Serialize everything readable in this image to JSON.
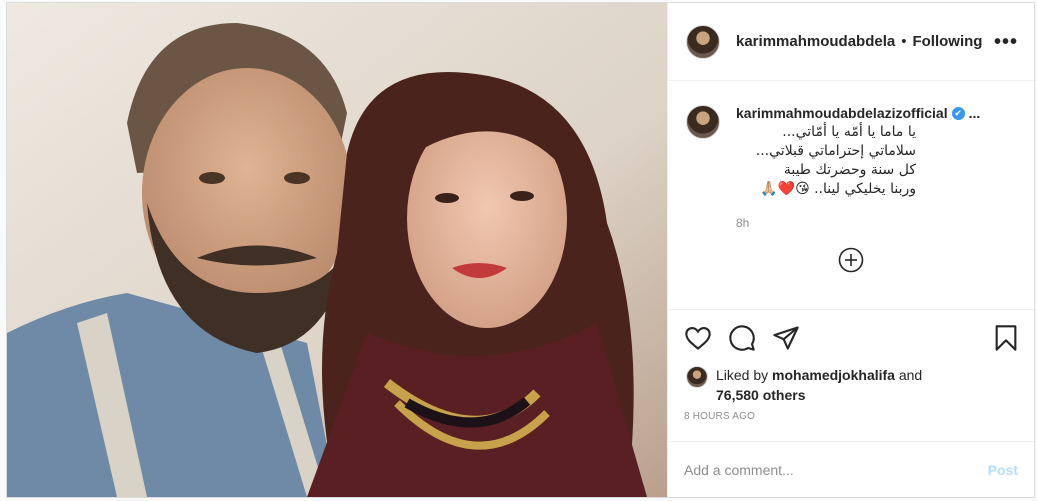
{
  "header": {
    "username": "karimmahmoudabdela",
    "separator": "•",
    "follow_status": "Following",
    "more_label": "•••"
  },
  "caption": {
    "username": "karimmahmoudabdelazizofficial",
    "verified_mark": "✔",
    "ellipsis": "...",
    "lines": [
      "يا ماما يا أمّه يا أمّاتي...",
      "سلاماتي إحتراماتي قبلاتي...",
      "كل سنة وحضرتك طيبة",
      "وربنا يخليكي لينا.. 😘❤️🙏🏼"
    ],
    "time": "8h"
  },
  "likes": {
    "prefix": "Liked by ",
    "liker": "mohamedjokhalifa",
    "and": " and",
    "others": "76,580 others"
  },
  "posted_ago": "8 HOURS AGO",
  "comment": {
    "placeholder": "Add a comment...",
    "post_label": "Post"
  },
  "colors": {
    "accent": "#3897f0",
    "post_disabled": "#b2dffc",
    "muted": "#8e8e8e",
    "border": "#dbdbdb"
  },
  "icons": [
    "heart-icon",
    "comment-icon",
    "share-icon",
    "bookmark-icon",
    "add-circle-icon",
    "verified-icon"
  ]
}
